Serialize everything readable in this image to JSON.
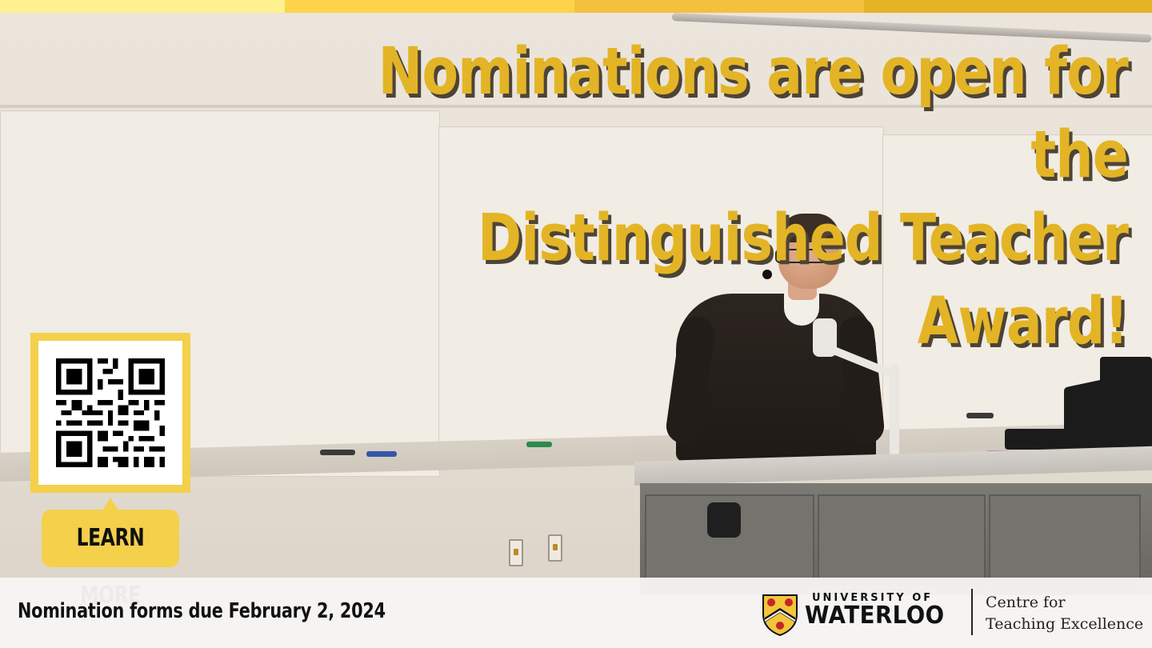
{
  "banner": {
    "headline_line1": "Nominations are open for the",
    "headline_line2": "Distinguished Teacher Award!",
    "learn_more_label": "LEARN MORE",
    "due_text": "Nomination forms due February 2, 2024"
  },
  "logo": {
    "university_small": "UNIVERSITY OF",
    "university_big": "WATERLOO",
    "centre_line1": "Centre for",
    "centre_line2": "Teaching Excellence"
  },
  "icons": {
    "qr": "qr-code-icon",
    "crest": "university-crest-icon"
  },
  "colors": {
    "accent_yellow": "#e3b425",
    "button_yellow": "#f4d04b",
    "headline_shadow": "#4e4436",
    "topbar": [
      "#fff18f",
      "#fed34c",
      "#f5c03e",
      "#e4b425"
    ]
  }
}
